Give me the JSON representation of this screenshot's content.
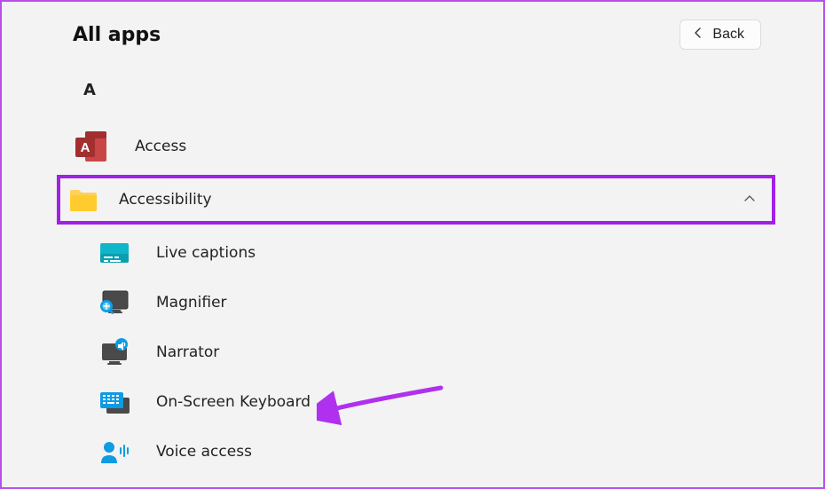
{
  "header": {
    "title": "All apps",
    "back_label": "Back"
  },
  "section_letter": "A",
  "apps": {
    "access": "Access",
    "accessibility": "Accessibility"
  },
  "sub_apps": {
    "live_captions": "Live captions",
    "magnifier": "Magnifier",
    "narrator": "Narrator",
    "on_screen_keyboard": "On-Screen Keyboard",
    "voice_access": "Voice access"
  }
}
